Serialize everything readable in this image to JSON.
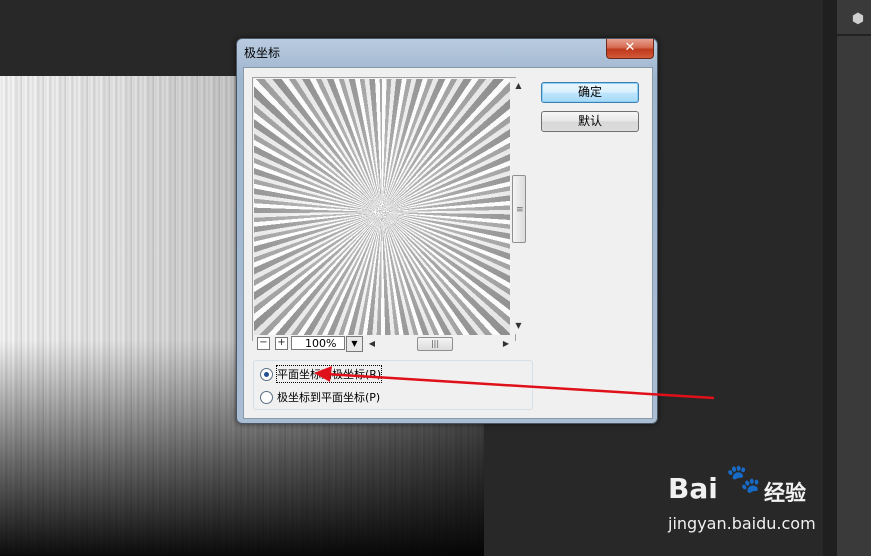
{
  "dialog": {
    "title": "极坐标",
    "close_label": "✕",
    "ok_label": "确定",
    "default_label": "默认",
    "zoom": {
      "minus": "−",
      "plus": "+",
      "value": "100%"
    },
    "options": [
      {
        "label": "平面坐标到极坐标(R)",
        "checked": true
      },
      {
        "label": "极坐标到平面坐标(P)",
        "checked": false
      }
    ]
  },
  "watermark": {
    "logo": "Bai",
    "paw": "🐾",
    "brand_cn": "经验",
    "url": "jingyan.baidu.com"
  },
  "icons": {
    "panel_tool": "3d-cube-icon",
    "close": "close-icon",
    "dropdown": "chevron-down-icon"
  },
  "colors": {
    "workspace_bg": "#282828",
    "arrow": "#e0101a",
    "close_button": "#c0391c"
  }
}
